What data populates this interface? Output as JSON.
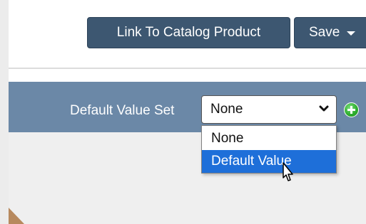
{
  "toolbar": {
    "link_label": "Link To Catalog Product",
    "save_label": "Save"
  },
  "default_value_set": {
    "label": "Default Value Set",
    "selected": "None",
    "options": [
      "None",
      "Default Value"
    ],
    "highlighted_option": "Default Value"
  },
  "colors": {
    "button_bg": "#3d5771",
    "header_bar": "#6b88a7",
    "highlight": "#1e6fd9",
    "add_icon": "#2fae2f"
  },
  "icons": {
    "save_caret": "caret-down-icon",
    "select_chevron": "chevron-down-icon",
    "add": "add-circle-icon",
    "cursor": "pointer-cursor-icon"
  }
}
